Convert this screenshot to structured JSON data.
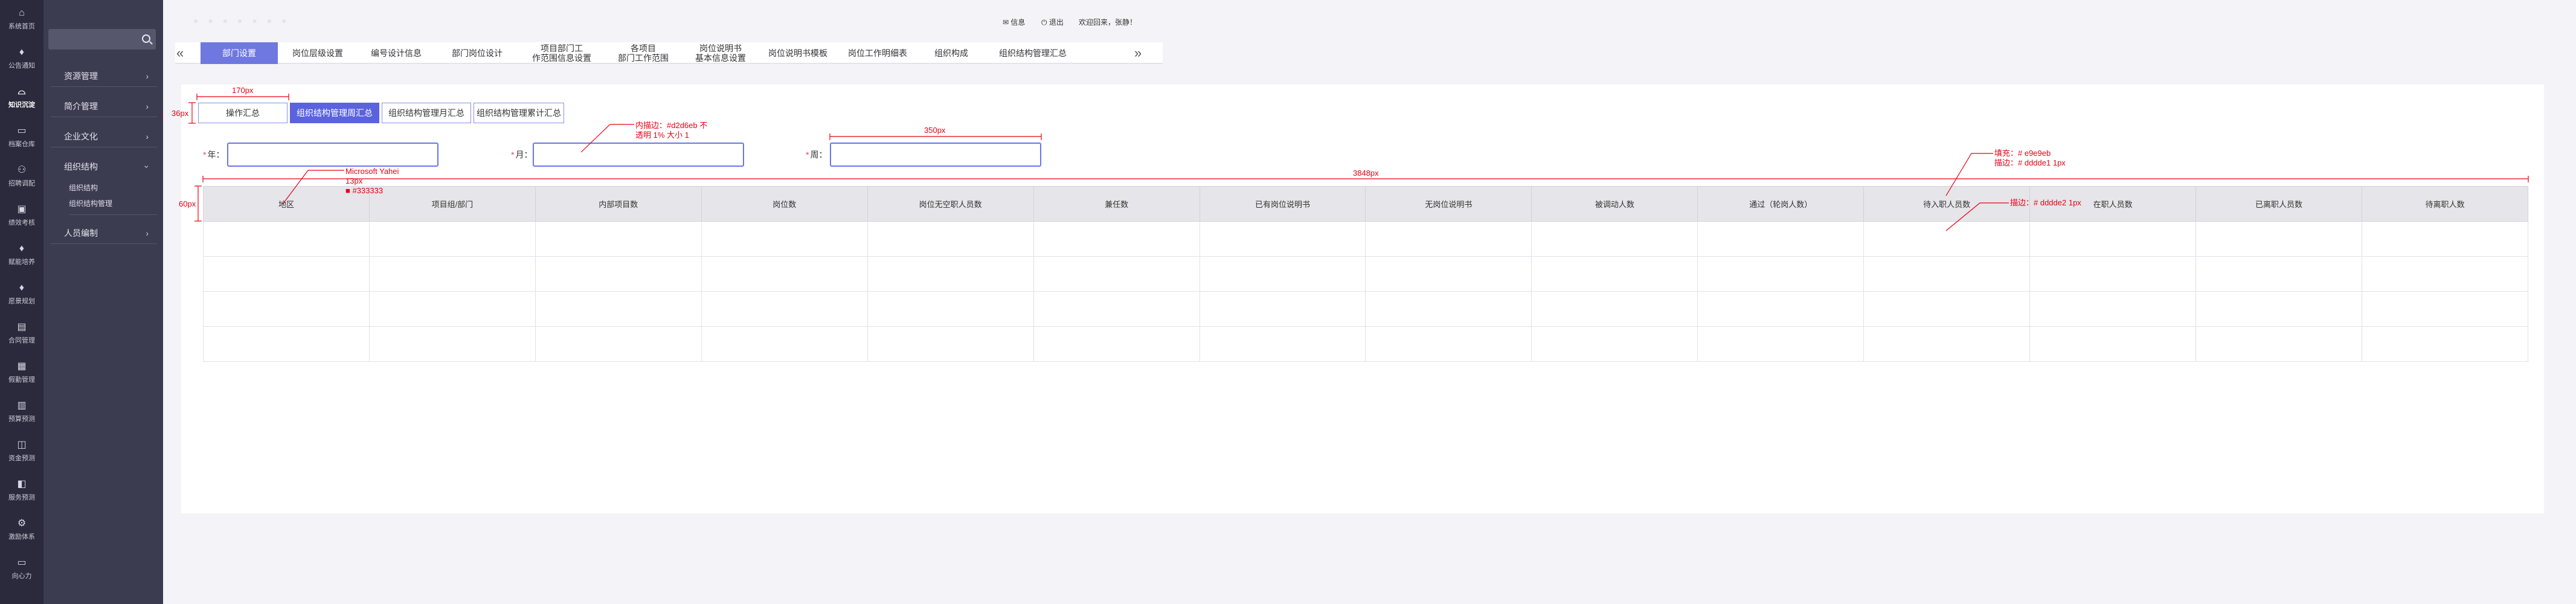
{
  "rail": {
    "items": [
      {
        "icon": "home-icon",
        "glyph": "⌂",
        "label": "系统首页"
      },
      {
        "icon": "notice-icon",
        "glyph": "♦",
        "label": "公告通知"
      },
      {
        "icon": "knowledge-icon",
        "glyph": "⌓",
        "label": "知识沉淀"
      },
      {
        "icon": "archive-icon",
        "glyph": "▭",
        "label": "档案仓库"
      },
      {
        "icon": "recruit-icon",
        "glyph": "⚇",
        "label": "招聘调配"
      },
      {
        "icon": "performance-icon",
        "glyph": "▣",
        "label": "绩效考核"
      },
      {
        "icon": "training-icon",
        "glyph": "♦",
        "label": "赋能培养"
      },
      {
        "icon": "vision-icon",
        "glyph": "♦",
        "label": "愿景规划"
      },
      {
        "icon": "contract-icon",
        "glyph": "▤",
        "label": "合同管理"
      },
      {
        "icon": "attendance-icon",
        "glyph": "▦",
        "label": "假勤管理"
      },
      {
        "icon": "budget-icon",
        "glyph": "▥",
        "label": "预算预测"
      },
      {
        "icon": "funds-icon",
        "glyph": "◫",
        "label": "资金预测"
      },
      {
        "icon": "service-icon",
        "glyph": "◧",
        "label": "服务预测"
      },
      {
        "icon": "incentive-icon",
        "glyph": "⚙",
        "label": "激励体系"
      },
      {
        "icon": "cohesion-icon",
        "glyph": "▭",
        "label": "向心力"
      }
    ],
    "active_index": 2
  },
  "submenu": {
    "search_placeholder": "",
    "groups": [
      {
        "label": "资源管理",
        "expanded": false
      },
      {
        "label": "简介管理",
        "expanded": false
      },
      {
        "label": "企业文化",
        "expanded": false
      },
      {
        "label": "组织结构",
        "expanded": true
      },
      {
        "label": "人员编制",
        "expanded": false
      }
    ],
    "subitems": [
      "组织结构",
      "组织结构管理"
    ]
  },
  "topbar": {
    "message_label": "信息",
    "logout_label": "退出",
    "welcome_text": "欢迎回来，张静！"
  },
  "tabs": [
    "部门设置",
    "岗位层级设置",
    "编号设计信息",
    "部门岗位设计",
    "项目部门工\n作范围信息设置",
    "各项目\n部门工作范围",
    "岗位说明书\n基本信息设置",
    "岗位说明书模板",
    "岗位工作明细表",
    "组织构成",
    "组织结构管理汇总"
  ],
  "active_tab": 0,
  "buttons": {
    "summary": "操作汇总",
    "weekly": "组织结构管理周汇总",
    "monthly": "组织结构管理月汇总",
    "cumulative": "组织结构管理累计汇总"
  },
  "filters": {
    "year_label": "年：",
    "month_label": "月：",
    "week_label": "周："
  },
  "table": {
    "columns": [
      "地区",
      "项目组/部门",
      "内部项目数",
      "岗位数",
      "岗位无空职人员数",
      "兼任数",
      "已有岗位说明书",
      "无岗位说明书",
      "被调动人数",
      "通过（轮岗人数）",
      "待入职人员数",
      "在职人员数",
      "已离职人员数",
      "待离职人数"
    ],
    "row_count": 4
  },
  "annotations": {
    "w170": "170px",
    "h36": "36px",
    "w350": "350px",
    "w3848": "3848px",
    "h60": "60px",
    "font_note": [
      "Microsoft Yahei",
      "13px",
      "■ #333333"
    ],
    "border_note": [
      "内描边：#d2d6eb  不",
      "透明 1%  大小 1"
    ],
    "fill_note": [
      "填充：# e9e9eb",
      "描边：# dddde1 1px"
    ],
    "stroke_note": "描边：# dddde2 1px"
  }
}
